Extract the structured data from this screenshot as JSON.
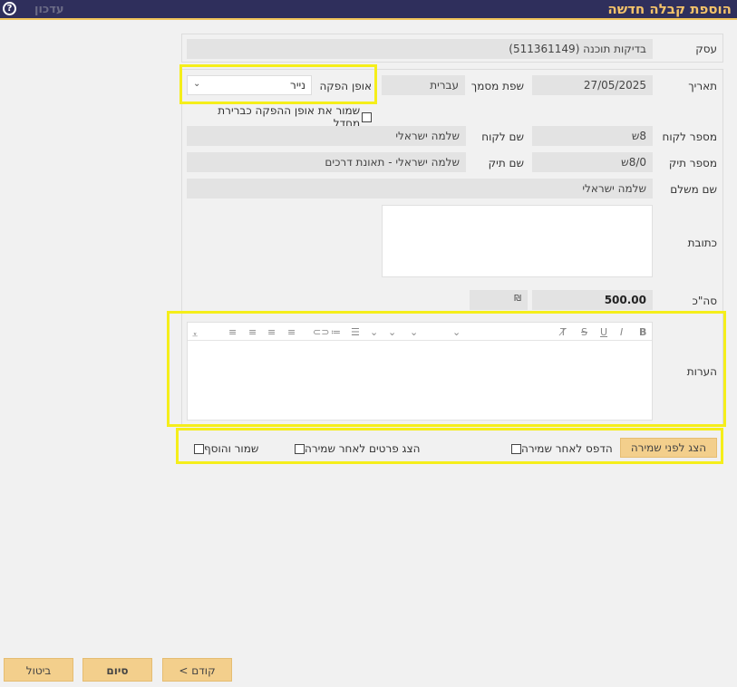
{
  "header": {
    "title": "הוספת קבלה חדשה",
    "refresh_label": "עדכון",
    "help_glyph": "?"
  },
  "form": {
    "business": {
      "label": "עסק",
      "value": "בדיקות תוכנה (511361149)"
    },
    "date": {
      "label": "תאריך",
      "value": "27/05/2025"
    },
    "doc_language": {
      "label": "שפת מסמך",
      "value": "עברית"
    },
    "delivery_method": {
      "label": "אופן הפקה",
      "value": "נייר"
    },
    "save_default": {
      "label": "שמור את אופן ההפקה כברירת מחדל"
    },
    "customer_number": {
      "label": "מספר לקוח",
      "value": "8ש"
    },
    "customer_name": {
      "label": "שם לקוח",
      "value": "שלמה ישראלי"
    },
    "file_number": {
      "label": "מספר תיק",
      "value": "8/0ש"
    },
    "file_name": {
      "label": "שם תיק",
      "value": "שלמה ישראלי - תאונת דרכים"
    },
    "payer_name": {
      "label": "שם משלם",
      "value": "שלמה ישראלי"
    },
    "address": {
      "label": "כתובת",
      "value": ""
    },
    "total": {
      "label": "סה\"כ",
      "value": "500.00",
      "currency": "₪"
    },
    "notes": {
      "label": "הערות",
      "value": ""
    }
  },
  "options": {
    "preview_button": "הצג לפני שמירה",
    "print_after_save": "הדפס לאחר שמירה",
    "show_details_after_save": "הצג פרטים לאחר שמירה",
    "save_and_add": "שמור והוסף"
  },
  "footer": {
    "prev_button": "< קודם",
    "finish_button": "סיום",
    "cancel_button": "ביטול"
  },
  "toolbar_icons": [
    "bold-icon",
    "italic-icon",
    "underline-icon",
    "strikethrough-icon",
    "clear-format-icon",
    "font-family-select",
    "font-size-select",
    "heading-select",
    "bullet-list-icon",
    "numbered-list-icon",
    "link-icon",
    "align-right-icon",
    "align-center-icon",
    "align-left-icon",
    "align-justify-icon",
    "more-icon"
  ]
}
